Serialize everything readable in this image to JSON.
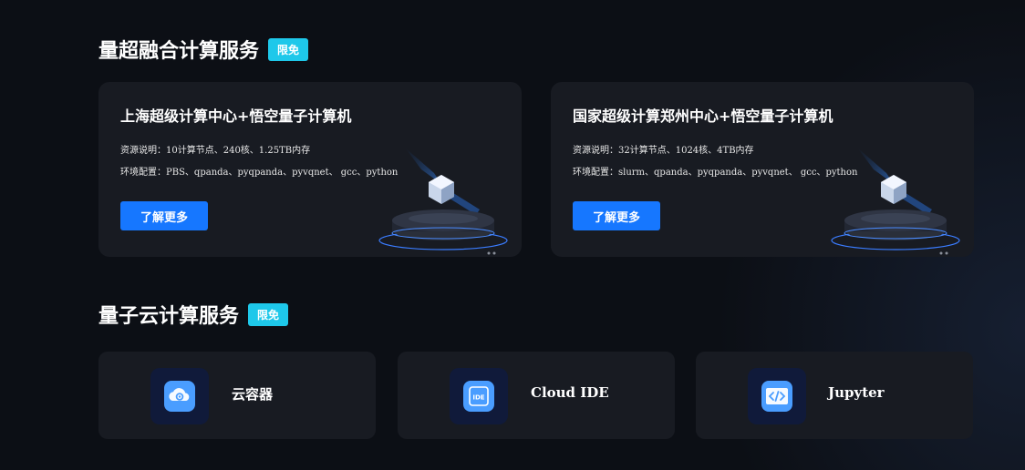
{
  "sections": {
    "fusion": {
      "title": "量超融合计算服务",
      "badge": "限免"
    },
    "cloud": {
      "title": "量子云计算服务",
      "badge": "限免"
    }
  },
  "cards": [
    {
      "title": "上海超级计算中心+悟空量子计算机",
      "resources": "资源说明：10计算节点、240核、1.25TB内存",
      "environment": "环境配置：PBS、qpanda、pyqpanda、pyvqnet、 gcc、python",
      "button": "了解更多"
    },
    {
      "title": "国家超级计算郑州中心+悟空量子计算机",
      "resources": "资源说明：32计算节点、1024核、4TB内存",
      "environment": "环境配置：slurm、qpanda、pyqpanda、pyvqnet、 gcc、python",
      "button": "了解更多"
    }
  ],
  "services": [
    {
      "label": "云容器",
      "icon": "cloud-gear-icon"
    },
    {
      "label": "Cloud IDE",
      "icon": "ide-icon"
    },
    {
      "label": "Jupyter",
      "icon": "code-brackets-icon"
    }
  ],
  "colors": {
    "accent": "#1677ff",
    "badge": "#1ec8ea",
    "card": "#181b22",
    "background": "#0c0f15"
  }
}
